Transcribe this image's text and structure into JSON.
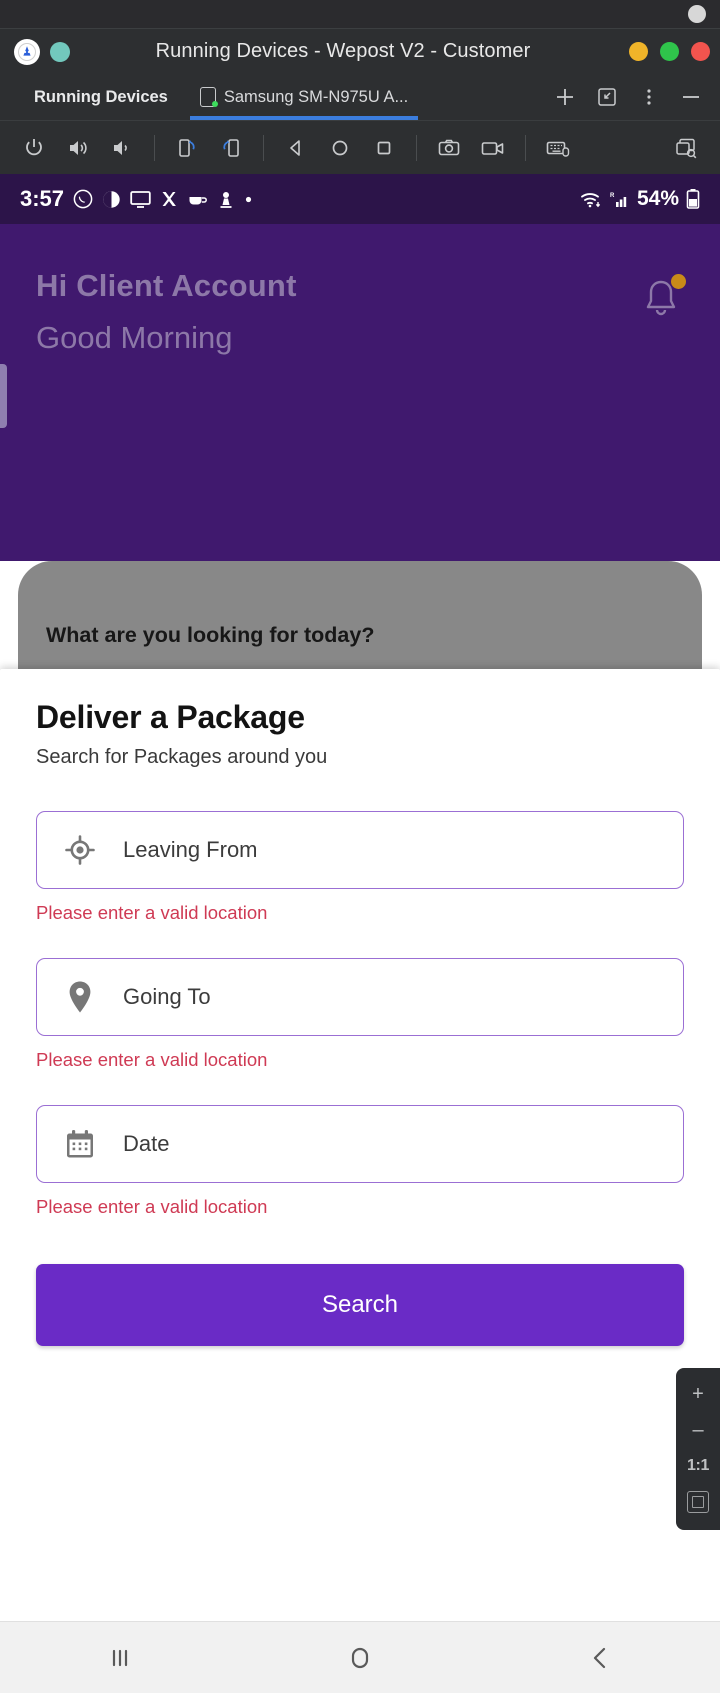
{
  "window": {
    "title": "Running Devices - Wepost V2 - Customer",
    "app_icon": "android-studio-icon",
    "buttons": [
      {
        "name": "minimize-button",
        "color": "#f0b429"
      },
      {
        "name": "maximize-button",
        "color": "#2fc44b"
      },
      {
        "name": "close-button",
        "color": "#f2544e"
      }
    ]
  },
  "tabs": {
    "panel_label": "Running Devices",
    "device_label": "Samsung SM-N975U A...",
    "actions": [
      {
        "name": "new-tab-button",
        "glyph": "+"
      },
      {
        "name": "dock-window-button",
        "glyph": "dock-icon"
      },
      {
        "name": "more-options-button",
        "glyph": "kebab-icon"
      },
      {
        "name": "minimize-tool-window-button",
        "glyph": "minus-icon"
      },
      {
        "name": "layout-inspector-button",
        "glyph": "layers-search-icon"
      }
    ]
  },
  "device_toolbar": {
    "items": [
      {
        "name": "power-button",
        "icon": "power-icon"
      },
      {
        "name": "volume-up-button",
        "icon": "volume-up-icon"
      },
      {
        "name": "volume-down-button",
        "icon": "volume-down-icon"
      },
      {
        "name": "rotate-left-button",
        "icon": "rotate-left-icon"
      },
      {
        "name": "rotate-right-button",
        "icon": "rotate-right-icon"
      },
      {
        "name": "back-button",
        "icon": "triangle-back-icon"
      },
      {
        "name": "home-button",
        "icon": "circle-home-icon"
      },
      {
        "name": "overview-button",
        "icon": "square-overview-icon"
      },
      {
        "name": "screenshot-button",
        "icon": "camera-icon"
      },
      {
        "name": "screen-record-button",
        "icon": "video-camera-icon"
      },
      {
        "name": "hardware-input-button",
        "icon": "keyboard-mouse-icon"
      },
      {
        "name": "layout-inspector-button",
        "icon": "window-search-icon"
      }
    ]
  },
  "android": {
    "statusbar": {
      "time": "3:57",
      "left_icons": [
        "whatsapp-icon",
        "contrast-icon",
        "monitor-icon",
        "x-twitter-icon",
        "coffee-icon",
        "microscope-icon",
        "dot-icon"
      ],
      "wifi_icon": "wifi-icon",
      "signal_icon": "cellular-signal-icon",
      "battery_text": "54%",
      "battery_icon": "battery-icon"
    },
    "navbar": [
      {
        "name": "nav-recents-button",
        "icon": "recents-icon"
      },
      {
        "name": "nav-home-button",
        "icon": "home-circle-icon"
      },
      {
        "name": "nav-back-button",
        "icon": "back-chevron-icon"
      }
    ]
  },
  "app": {
    "greeting": "Hi Client Account",
    "greeting_sub": "Good Morning",
    "notification_icon": "bell-icon",
    "header_bg": "#40196e",
    "body_prompt": "What are you looking for today?",
    "categories": [
      {
        "name": "category-track",
        "icon": "target-icon"
      },
      {
        "name": "category-send",
        "icon": "paper-plane-icon"
      },
      {
        "name": "category-package",
        "icon": "box-icon"
      }
    ]
  },
  "sheet": {
    "title": "Deliver a Package",
    "subtitle": "Search for Packages around you",
    "accent_color": "#9b6fd4",
    "error_color": "#cf3a54",
    "button_color": "#6a2bc6",
    "fields": [
      {
        "name": "leaving-from-field",
        "icon": "gps-target-icon",
        "placeholder": "Leaving From",
        "error": "Please enter a valid location"
      },
      {
        "name": "going-to-field",
        "icon": "map-pin-icon",
        "placeholder": "Going To",
        "error": "Please enter a valid location"
      },
      {
        "name": "date-field",
        "icon": "calendar-icon",
        "placeholder": "Date",
        "error": "Please enter a valid location"
      }
    ],
    "search_button": "Search"
  },
  "float_controls": [
    {
      "name": "zoom-in-button",
      "label": "+"
    },
    {
      "name": "zoom-out-button",
      "label": "–"
    },
    {
      "name": "zoom-actual-size-button",
      "label": "1:1"
    },
    {
      "name": "zoom-fit-button",
      "label": ""
    }
  ]
}
